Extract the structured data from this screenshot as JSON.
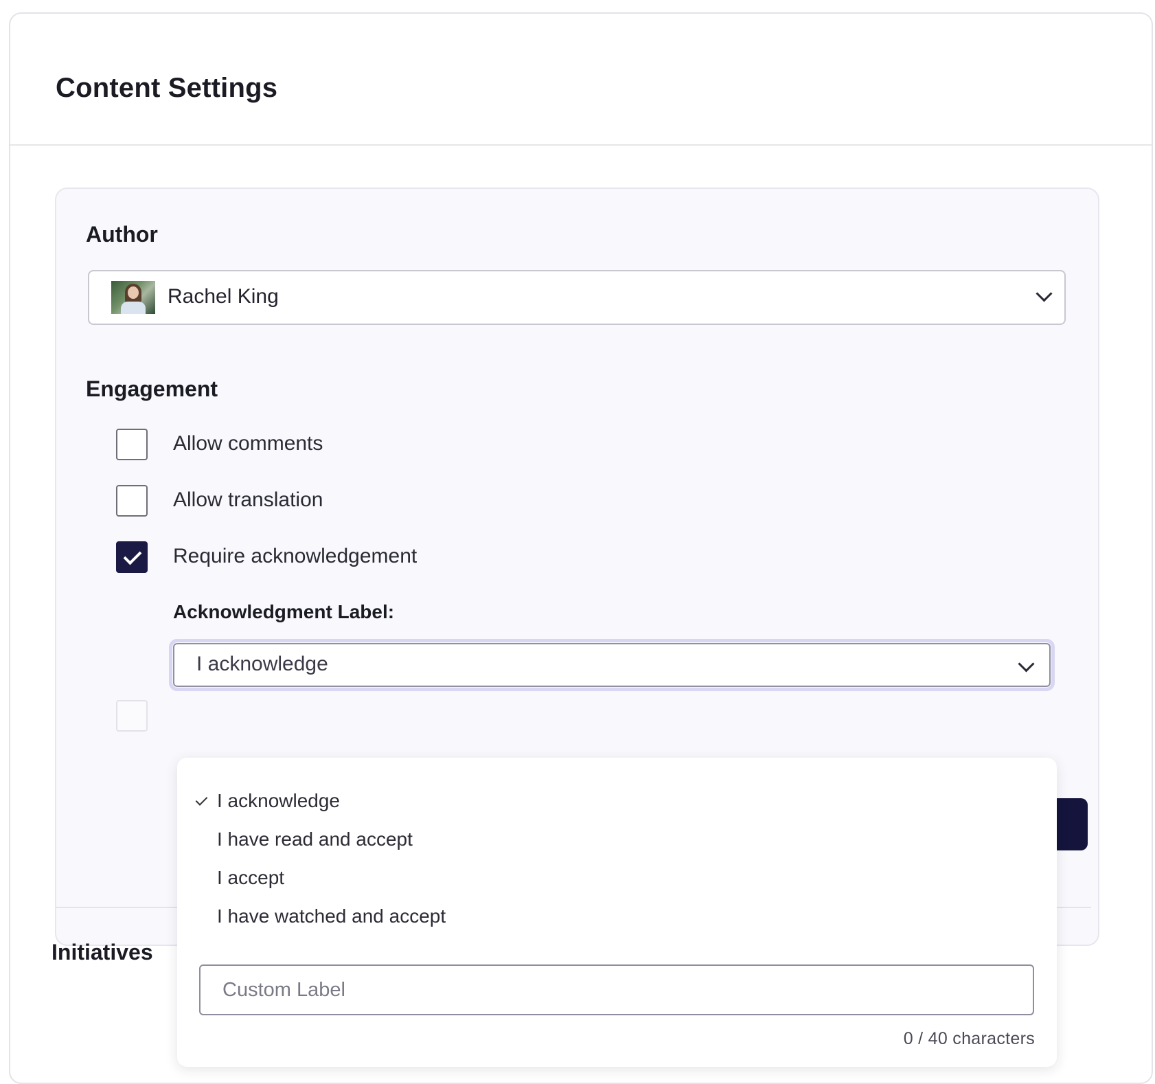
{
  "header": {
    "title": "Content Settings"
  },
  "author": {
    "label": "Author",
    "selected_name": "Rachel King",
    "icons": {
      "avatar": "avatar-photo",
      "chevron": "chevron-down-icon"
    }
  },
  "engagement": {
    "label": "Engagement",
    "options": [
      {
        "label": "Allow comments",
        "checked": false
      },
      {
        "label": "Allow translation",
        "checked": false
      },
      {
        "label": "Require acknowledgement",
        "checked": true
      }
    ],
    "acknowledgment": {
      "label": "Acknowledgment Label:",
      "selected": "I acknowledge",
      "menu": {
        "options": [
          {
            "label": "I acknowledge",
            "selected": true
          },
          {
            "label": "I have read and accept",
            "selected": false
          },
          {
            "label": "I accept",
            "selected": false
          },
          {
            "label": "I have watched and accept",
            "selected": false
          }
        ],
        "custom_placeholder": "Custom Label",
        "char_count": "0 / 40 characters"
      }
    }
  },
  "initiatives": {
    "label": "Initiatives"
  },
  "colors": {
    "accent": "#1a1a44",
    "focus_ring": "#d8d6f3"
  }
}
